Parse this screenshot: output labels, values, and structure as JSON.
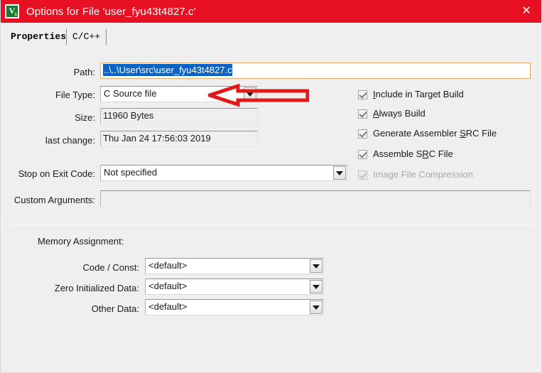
{
  "window": {
    "title": "Options for File 'user_fyu43t4827.c'",
    "icon_name": "vision-app-icon",
    "icon_glyph": "V",
    "icon_subglyph": "s",
    "close_label": "✕",
    "titlebar_color": "#e81123",
    "dialog_background": "#efefef"
  },
  "tabs": [
    {
      "label": "Properties",
      "active": true
    },
    {
      "label": "C/C++",
      "active": false
    }
  ],
  "properties": {
    "path": {
      "label": "Path:",
      "value": "..\\..\\User\\src\\user_fyu43t4827.c",
      "selected": true
    },
    "file_type": {
      "label": "File Type:",
      "value": "C Source file"
    },
    "size": {
      "label": "Size:",
      "value": "11960 Bytes"
    },
    "last_change": {
      "label": "last change:",
      "value": "Thu Jan 24 17:56:03 2019"
    },
    "stop_on_exit_code": {
      "label": "Stop on Exit Code:",
      "value": "Not specified"
    },
    "custom_arguments": {
      "label": "Custom Arguments:",
      "value": ""
    }
  },
  "checkboxes": [
    {
      "label_pre": "",
      "label_accel": "I",
      "label_post": "nclude in Target Build",
      "checked": true,
      "disabled": false
    },
    {
      "label_pre": "",
      "label_accel": "A",
      "label_post": "lways Build",
      "checked": true,
      "disabled": false
    },
    {
      "label_pre": "Generate Assembler ",
      "label_accel": "S",
      "label_post": "RC File",
      "checked": true,
      "disabled": false
    },
    {
      "label_pre": "Assemble S",
      "label_accel": "R",
      "label_post": "C File",
      "checked": true,
      "disabled": false
    },
    {
      "label_pre": "Image File Compression",
      "label_accel": "",
      "label_post": "",
      "checked": true,
      "disabled": true
    }
  ],
  "memory_assignment": {
    "section_label": "Memory Assignment:",
    "rows": [
      {
        "label": "Code / Const:",
        "value": "<default>"
      },
      {
        "label": "Zero Initialized Data:",
        "value": "<default>"
      },
      {
        "label": "Other Data:",
        "value": "<default>"
      }
    ]
  },
  "annotation": {
    "arrow_name": "red-left-arrow-annotation",
    "color": "#e01a1a",
    "points_at": "File Type dropdown arrow"
  }
}
